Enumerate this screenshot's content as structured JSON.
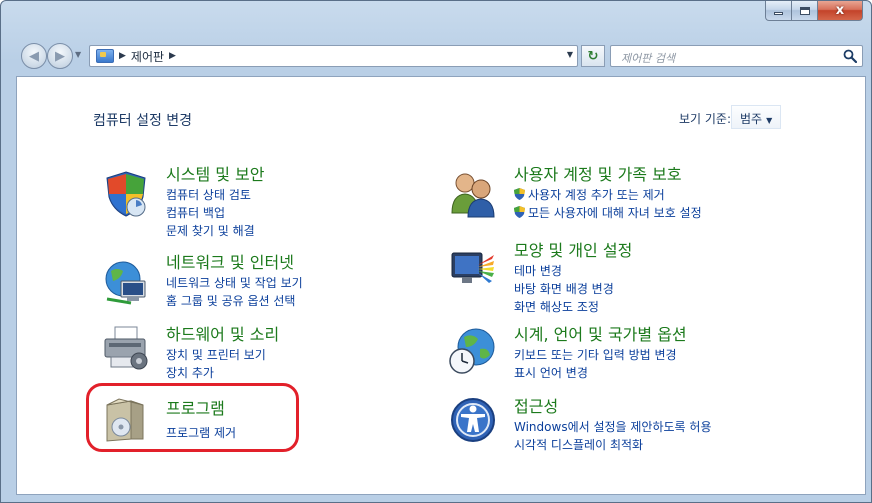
{
  "window": {
    "minimize_label": "",
    "maximize_label": "",
    "close_label": "x"
  },
  "address_bar": {
    "breadcrumb": "제어판",
    "search_placeholder": "제어판 검색"
  },
  "header": {
    "title": "컴퓨터 설정 변경",
    "view_by_label": "보기 기준:",
    "view_by_value": "범주"
  },
  "categories": {
    "system_security": {
      "title": "시스템 및 보안",
      "links": [
        "컴퓨터 상태 검토",
        "컴퓨터 백업",
        "문제 찾기 및 해결"
      ]
    },
    "network": {
      "title": "네트워크 및 인터넷",
      "links": [
        "네트워크 상태 및 작업 보기",
        "홈 그룹 및 공유 옵션 선택"
      ]
    },
    "hardware": {
      "title": "하드웨어 및 소리",
      "links": [
        "장치 및 프린터 보기",
        "장치 추가"
      ]
    },
    "programs": {
      "title": "프로그램",
      "links": [
        "프로그램 제거"
      ]
    },
    "user_accounts": {
      "title": "사용자 계정 및 가족 보호",
      "links": [
        "사용자 계정 추가 또는 제거",
        "모든 사용자에 대해 자녀 보호 설정"
      ]
    },
    "appearance": {
      "title": "모양 및 개인 설정",
      "links": [
        "테마 변경",
        "바탕 화면 배경 변경",
        "화면 해상도 조정"
      ]
    },
    "clock_region": {
      "title": "시계, 언어 및 국가별 옵션",
      "links": [
        "키보드 또는 기타 입력 방법 변경",
        "표시 언어 변경"
      ]
    },
    "ease_of_access": {
      "title": "접근성",
      "links": [
        "Windows에서 설정을 제안하도록 허용",
        "시각적 디스플레이 최적화"
      ]
    }
  },
  "colors": {
    "category_title": "#1c7a1c",
    "link": "#0b3f9b",
    "highlight": "#e2202a"
  },
  "icons": {
    "system_security": "shield-icon",
    "network": "network-globe-icon",
    "hardware": "printer-icon",
    "programs": "program-box-icon",
    "user_accounts": "users-icon",
    "appearance": "monitor-colors-icon",
    "clock_region": "globe-clock-icon",
    "ease_of_access": "accessibility-icon"
  }
}
